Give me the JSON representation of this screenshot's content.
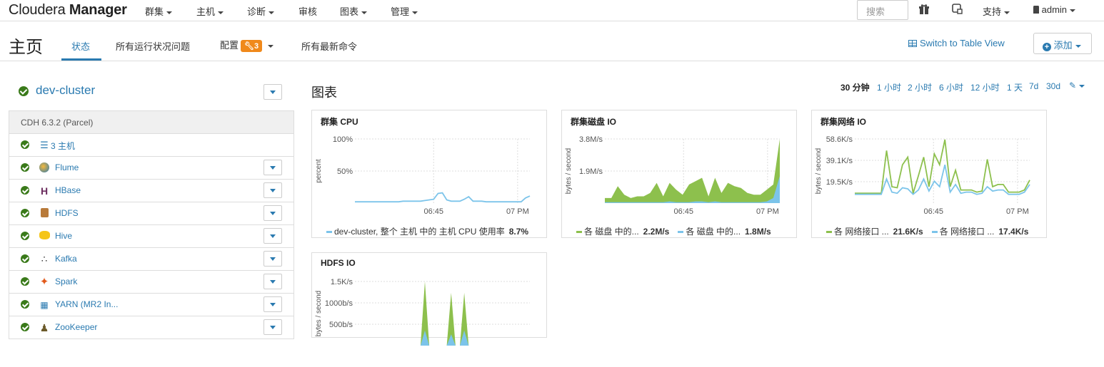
{
  "navbar": {
    "logo_light": "Cloudera",
    "logo_bold": "Manager",
    "items": [
      "群集",
      "主机",
      "诊断",
      "审核",
      "图表",
      "管理"
    ],
    "search_placeholder": "搜索",
    "support": "支持",
    "user": "admin"
  },
  "subbar": {
    "title": "主页",
    "tabs": [
      "状态",
      "所有运行状况问题",
      "配置",
      "所有最新命令"
    ],
    "config_badge": "3",
    "switch_link": "Switch to Table View",
    "add_button": "添加"
  },
  "cluster": {
    "name": "dev-cluster",
    "version": "CDH 6.3.2 (Parcel)",
    "hosts": "3 主机",
    "services": [
      {
        "name": "Flume",
        "icon": "flume-icon"
      },
      {
        "name": "HBase",
        "icon": "hbase-icon"
      },
      {
        "name": "HDFS",
        "icon": "hdfs-icon"
      },
      {
        "name": "Hive",
        "icon": "hive-icon"
      },
      {
        "name": "Kafka",
        "icon": "kafka-icon"
      },
      {
        "name": "Spark",
        "icon": "spark-icon"
      },
      {
        "name": "YARN (MR2 In...",
        "icon": "yarn-icon"
      },
      {
        "name": "ZooKeeper",
        "icon": "zookeeper-icon"
      }
    ]
  },
  "charts_section": {
    "title": "图表",
    "ranges": [
      "30 分钟",
      "1 小时",
      "2 小时",
      "6 小时",
      "12 小时",
      "1 天",
      "7d",
      "30d"
    ],
    "active_range": "30 分钟"
  },
  "colors": {
    "accent": "#2a7ab0",
    "green": "#8dc04d",
    "blue": "#7cc4ea",
    "badge": "#f0891b",
    "ok": "#3a7a1a"
  },
  "chart_data": [
    {
      "type": "line",
      "title": "群集 CPU",
      "ylabel": "percent",
      "yticks": [
        "100%",
        "50%"
      ],
      "xticks": [
        "06:45",
        "07 PM"
      ],
      "ylim": [
        0,
        100
      ],
      "series": [
        {
          "name": "dev-cluster, 整个 主机 中的 主机 CPU 使用率",
          "summary": "8.7%",
          "color": "#7cc4ea",
          "values": [
            2,
            2,
            2,
            2,
            2,
            2,
            2,
            2,
            2,
            2,
            2,
            3,
            3,
            3,
            3,
            3,
            4,
            5,
            6,
            15,
            16,
            5,
            3,
            3,
            3,
            6,
            10,
            3,
            3,
            3,
            2,
            2,
            2,
            2,
            2,
            2,
            2,
            2,
            2,
            8,
            11
          ]
        }
      ]
    },
    {
      "type": "area",
      "title": "群集磁盘 IO",
      "ylabel": "bytes / second",
      "yticks": [
        "3.8M/s",
        "1.9M/s"
      ],
      "xticks": [
        "06:45",
        "07 PM"
      ],
      "ylim": [
        0,
        3.8
      ],
      "series": [
        {
          "name": "各 磁盘 中的...",
          "summary": "2.2M/s",
          "color": "#8dc04d",
          "values": [
            0.3,
            0.3,
            1.0,
            0.5,
            0.3,
            0.4,
            0.4,
            0.6,
            1.2,
            0.4,
            1.2,
            0.8,
            0.5,
            1.1,
            1.3,
            1.5,
            0.4,
            1.5,
            0.6,
            1.2,
            1.0,
            0.9,
            0.6,
            0.5,
            0.5,
            0.8,
            1.1,
            3.8
          ]
        },
        {
          "name": "各 磁盘 中的...",
          "summary": "1.8M/s",
          "color": "#7cc4ea",
          "values": [
            0.05,
            0.05,
            0.05,
            0.05,
            0.05,
            0.05,
            0.05,
            0.05,
            0.05,
            0.05,
            0.1,
            0.05,
            0.05,
            0.05,
            0.1,
            0.1,
            0.05,
            0.1,
            0.05,
            0.05,
            0.05,
            0.05,
            0.05,
            0.05,
            0.05,
            0.1,
            0.3,
            1.6
          ]
        }
      ]
    },
    {
      "type": "line",
      "title": "群集网络 IO",
      "ylabel": "bytes / second",
      "yticks": [
        "58.6K/s",
        "39.1K/s",
        "19.5K/s"
      ],
      "xticks": [
        "06:45",
        "07 PM"
      ],
      "ylim": [
        0,
        58.6
      ],
      "series": [
        {
          "name": "各 网络接口 ...",
          "summary": "21.6K/s",
          "color": "#8dc04d",
          "values": [
            9,
            9,
            9,
            9,
            9,
            9,
            48,
            15,
            14,
            35,
            42,
            9,
            25,
            42,
            15,
            45,
            35,
            58,
            15,
            30,
            12,
            12,
            12,
            10,
            11,
            40,
            15,
            17,
            17,
            10,
            10,
            10,
            12,
            21
          ]
        },
        {
          "name": "各 网络接口 ...",
          "summary": "17.4K/s",
          "color": "#7cc4ea",
          "values": [
            8,
            8,
            8,
            8,
            8,
            8,
            22,
            10,
            9,
            14,
            13,
            8,
            12,
            22,
            11,
            20,
            15,
            35,
            10,
            17,
            9,
            10,
            10,
            8,
            9,
            15,
            11,
            12,
            12,
            8,
            8,
            8,
            10,
            17
          ]
        }
      ]
    },
    {
      "type": "area",
      "title": "HDFS IO",
      "ylabel": "bytes / second",
      "yticks": [
        "1.5K/s",
        "1000b/s",
        "500b/s"
      ],
      "xticks": [],
      "ylim": [
        0,
        1.7
      ],
      "series": [
        {
          "name": "",
          "color": "#8dc04d",
          "values": [
            0,
            0,
            0,
            0,
            0,
            0,
            0,
            0,
            0,
            0,
            0,
            0,
            0,
            0,
            0,
            0,
            1.7,
            0,
            0,
            0,
            0,
            0,
            1.4,
            0,
            0,
            1.4,
            0,
            0,
            0,
            0,
            0,
            0,
            0,
            0,
            0,
            0,
            0,
            0,
            0,
            0,
            0
          ]
        },
        {
          "name": "",
          "color": "#7cc4ea",
          "values": [
            0,
            0,
            0,
            0,
            0,
            0,
            0,
            0,
            0,
            0,
            0,
            0,
            0,
            0,
            0,
            0,
            0.4,
            0,
            0,
            0,
            0,
            0,
            0.3,
            0,
            0,
            0.4,
            0,
            0,
            0,
            0,
            0,
            0,
            0,
            0,
            0,
            0,
            0,
            0,
            0,
            0,
            0
          ]
        }
      ]
    }
  ]
}
